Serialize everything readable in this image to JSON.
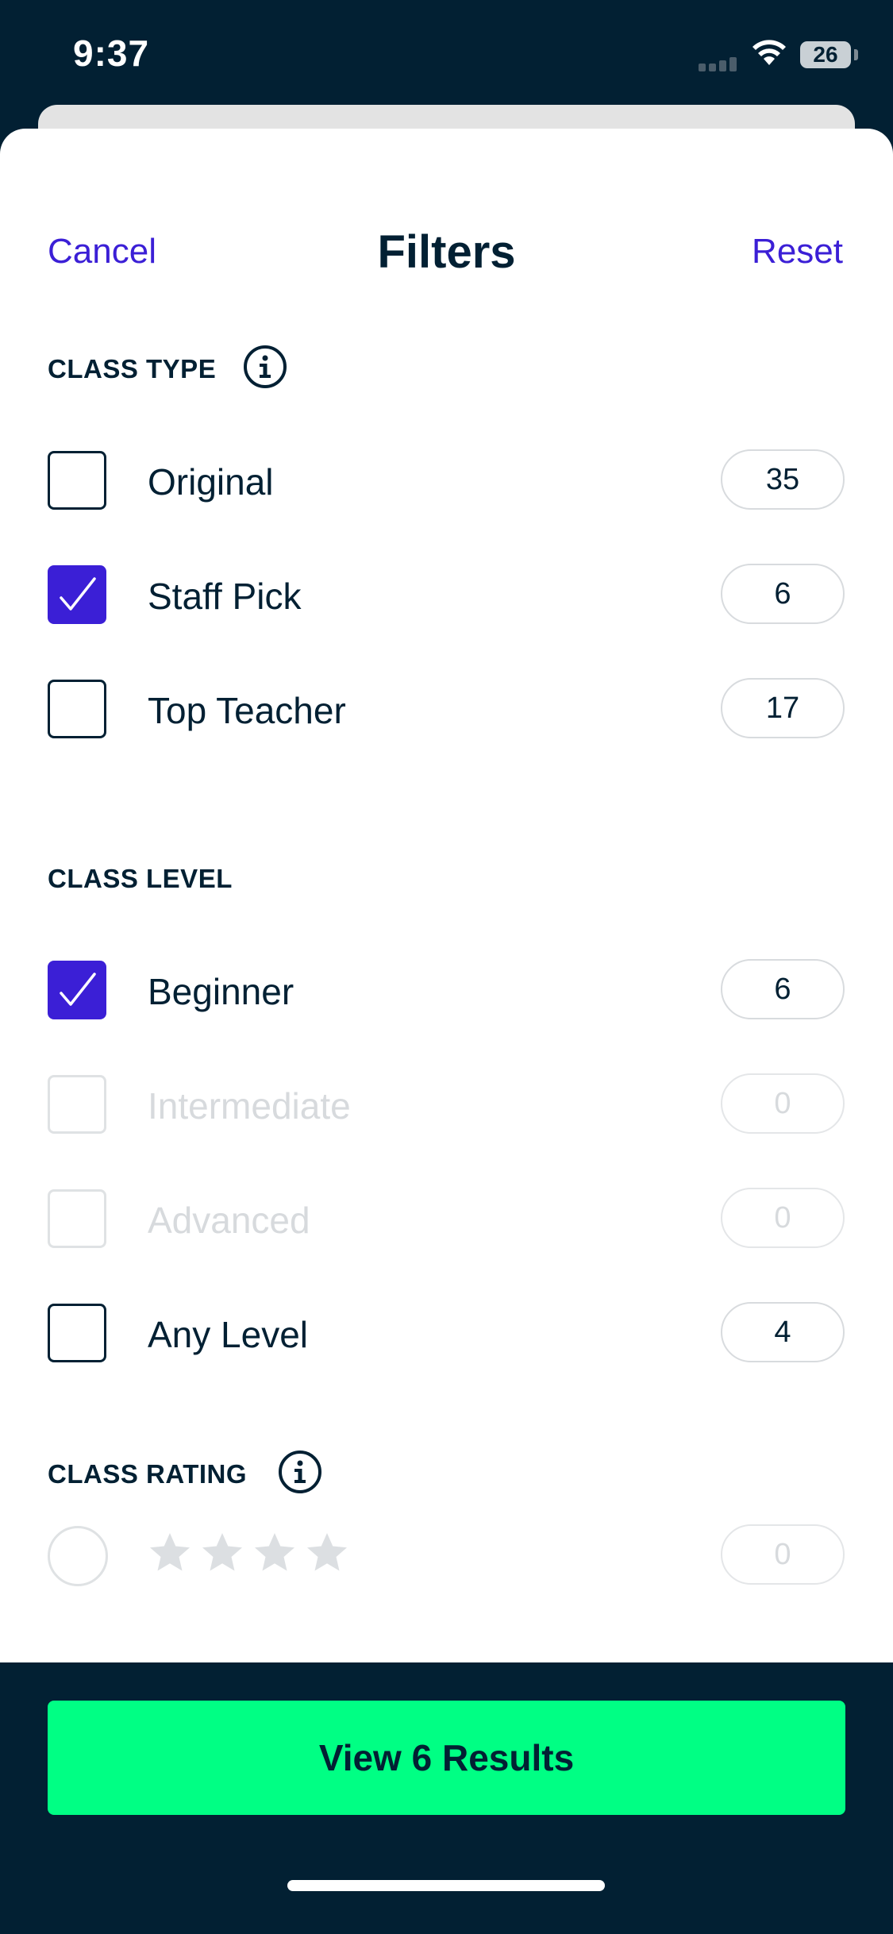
{
  "status_bar": {
    "time": "9:37",
    "battery": "26"
  },
  "header": {
    "cancel": "Cancel",
    "title": "Filters",
    "reset": "Reset"
  },
  "class_type": {
    "title": "CLASS TYPE",
    "options": [
      {
        "label": "Original",
        "count": "35",
        "checked": false
      },
      {
        "label": "Staff Pick",
        "count": "6",
        "checked": true
      },
      {
        "label": "Top Teacher",
        "count": "17",
        "checked": false
      }
    ]
  },
  "class_level": {
    "title": "CLASS LEVEL",
    "options": [
      {
        "label": "Beginner",
        "count": "6",
        "checked": true
      },
      {
        "label": "Intermediate",
        "count": "0",
        "checked": false,
        "disabled": true
      },
      {
        "label": "Advanced",
        "count": "0",
        "checked": false,
        "disabled": true
      },
      {
        "label": "Any Level",
        "count": "4",
        "checked": false
      }
    ]
  },
  "class_rating": {
    "title": "CLASS RATING",
    "options": [
      {
        "stars": 4,
        "count": "0",
        "disabled": true
      }
    ]
  },
  "footer": {
    "cta": "View 6 Results"
  },
  "colors": {
    "accent": "#3b1fd6",
    "cta": "#00ff84",
    "dark": "#022033"
  }
}
